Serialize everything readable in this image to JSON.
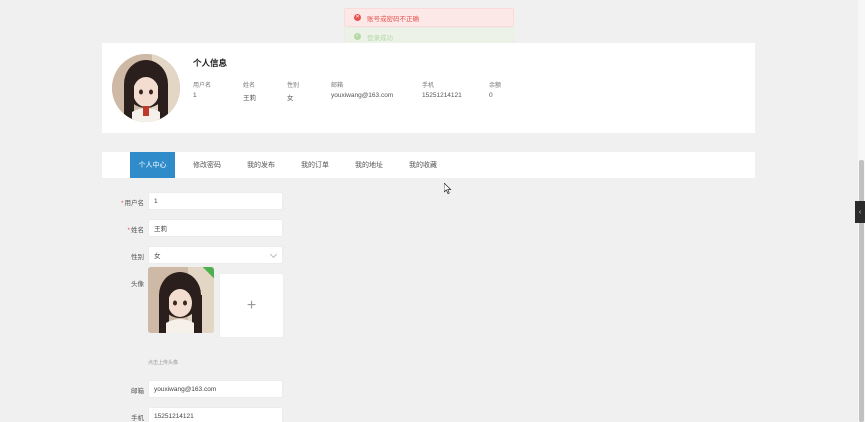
{
  "toasts": {
    "error": "账号或密码不正确",
    "success": "登录成功"
  },
  "profile": {
    "title": "个人信息",
    "fields": [
      {
        "label": "用户名",
        "value": "1"
      },
      {
        "label": "姓名",
        "value": "王莉"
      },
      {
        "label": "性别",
        "value": "女"
      },
      {
        "label": "邮箱",
        "value": "youxiwang@163.com"
      },
      {
        "label": "手机",
        "value": "15251214121"
      },
      {
        "label": "余额",
        "value": "0"
      }
    ]
  },
  "tabs": [
    "个人中心",
    "修改密码",
    "我的发布",
    "我的订单",
    "我的地址",
    "我的收藏"
  ],
  "form": {
    "username": {
      "label": "用户名",
      "value": "1"
    },
    "name": {
      "label": "姓名",
      "value": "王莉"
    },
    "gender": {
      "label": "性别",
      "value": "女"
    },
    "avatar": {
      "label": "头像",
      "tip": "点击上传头像"
    },
    "email": {
      "label": "邮箱",
      "value": "youxiwang@163.com"
    },
    "phone": {
      "label": "手机",
      "value": "15251214121"
    }
  },
  "icons": {
    "error": "close-circle-icon",
    "success": "check-circle-icon",
    "upload": "plus-icon",
    "handle": "chevron-left-icon"
  },
  "colors": {
    "accent": "#2f8bc9",
    "error": "#e5524d",
    "success": "#6abf4b"
  }
}
